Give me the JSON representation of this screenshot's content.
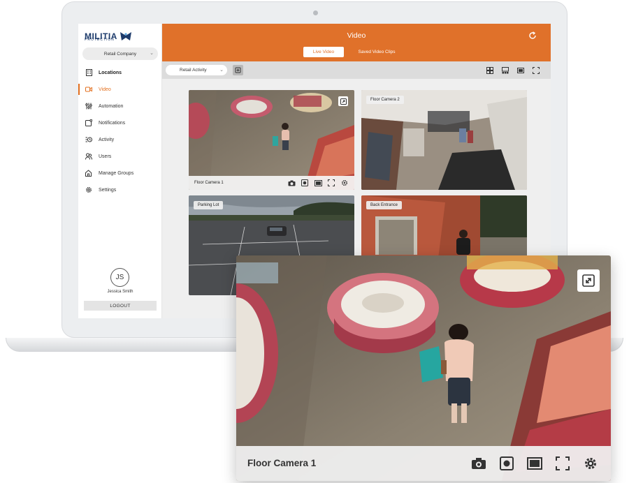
{
  "brand": {
    "name": "MILITIA",
    "tagline": "PROTECTION",
    "accent": "#e0712a",
    "navy": "#1d3b6b"
  },
  "sidebar": {
    "company": "Retail Company",
    "items": [
      {
        "label": "Locations",
        "icon": "building-icon"
      },
      {
        "label": "Video",
        "icon": "video-camera-icon"
      },
      {
        "label": "Automation",
        "icon": "sliders-icon"
      },
      {
        "label": "Notifications",
        "icon": "bell-square-icon"
      },
      {
        "label": "Activity",
        "icon": "activity-list-icon"
      },
      {
        "label": "Users",
        "icon": "users-icon"
      },
      {
        "label": "Manage Groups",
        "icon": "house-group-icon"
      },
      {
        "label": "Settings",
        "icon": "gear-icon"
      }
    ],
    "user_initials": "JS",
    "user_name": "Jessica Smith",
    "logout": "LOGOUT"
  },
  "header": {
    "title": "Video",
    "tabs": [
      {
        "label": "Live Video",
        "active": true
      },
      {
        "label": "Saved Video Clips",
        "active": false
      }
    ]
  },
  "toolbar": {
    "activity_select": "Retail Activity"
  },
  "tiles": [
    {
      "label": "Floor Camera 1"
    },
    {
      "label": "Floor Camera 2"
    },
    {
      "label": "Parking Lot"
    },
    {
      "label": "Back Entrance"
    }
  ],
  "popout": {
    "label": "Floor Camera 1"
  }
}
